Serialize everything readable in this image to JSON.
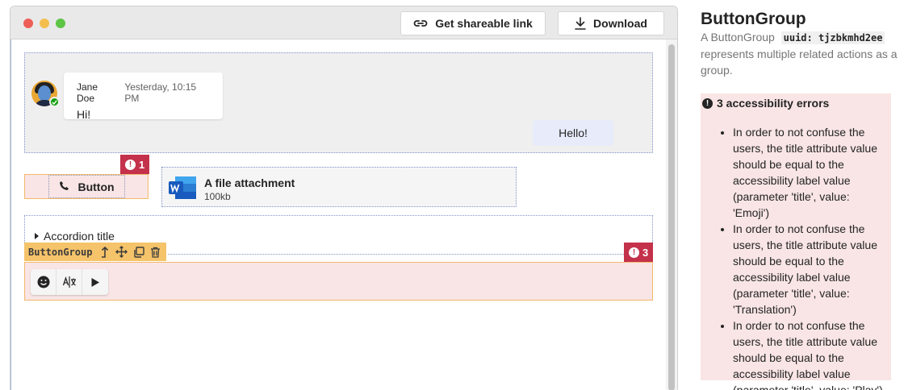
{
  "toolbar": {
    "share_label": "Get shareable link",
    "download_label": "Download"
  },
  "chat": {
    "author": "Jane Doe",
    "timestamp": "Yesterday, 10:15 PM",
    "incoming_text": "Hi!",
    "outgoing_text": "Hello!"
  },
  "button_row": {
    "error_count": "1",
    "button_label": "Button",
    "attachment_title": "A file attachment",
    "attachment_size": "100kb"
  },
  "accordion": {
    "title": "Accordion title"
  },
  "button_group": {
    "component_name": "ButtonGroup",
    "error_count": "3",
    "buttons": [
      "emoji",
      "translation",
      "play"
    ]
  },
  "panel": {
    "title": "ButtonGroup",
    "desc_before": "A ButtonGroup",
    "uuid": "uuid: tjzbkmhd2ee",
    "desc_after": "represents multiple related actions as a group.",
    "errors_heading": "3 accessibility errors",
    "errors": [
      "In order to not confuse the users, the title attribute value should be equal to the accessibility label value (parameter 'title', value: 'Emoji')",
      "In order to not confuse the users, the title attribute value should be equal to the accessibility label value (parameter 'title', value: 'Translation')",
      "In order to not confuse the users, the title attribute value should be equal to the accessibility label value (parameter 'title', value: 'Play')"
    ]
  },
  "colors": {
    "error": "#c4314b",
    "highlight": "#f5c36a",
    "error_bg": "#f9e5e5",
    "selection_outline": "#7f94c8"
  }
}
